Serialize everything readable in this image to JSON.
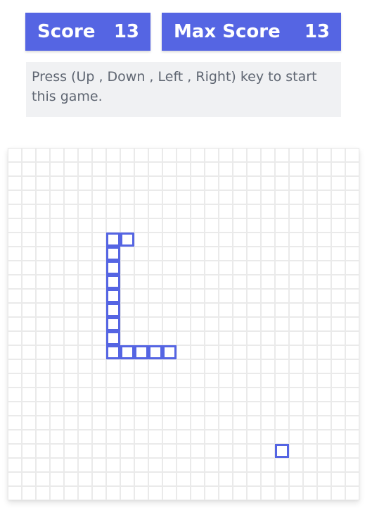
{
  "scores": {
    "score_label": "Score",
    "score_value": "13",
    "max_label": "Max Score",
    "max_value": "13"
  },
  "instructions": "Press (Up , Down , Left , Right) key to start this game.",
  "board": {
    "columns": 25,
    "rows": 25,
    "snake": [
      {
        "col": 7,
        "row": 6
      },
      {
        "col": 8,
        "row": 6
      },
      {
        "col": 7,
        "row": 7
      },
      {
        "col": 7,
        "row": 8
      },
      {
        "col": 7,
        "row": 9
      },
      {
        "col": 7,
        "row": 10
      },
      {
        "col": 7,
        "row": 11
      },
      {
        "col": 7,
        "row": 12
      },
      {
        "col": 7,
        "row": 13
      },
      {
        "col": 7,
        "row": 14
      },
      {
        "col": 8,
        "row": 14
      },
      {
        "col": 9,
        "row": 14
      },
      {
        "col": 10,
        "row": 14
      },
      {
        "col": 11,
        "row": 14
      }
    ],
    "food": {
      "col": 19,
      "row": 21
    }
  },
  "colors": {
    "accent": "#5565e3",
    "grid_line": "#eaeaea",
    "instruction_bg": "#f0f1f3",
    "instruction_text": "#5f6672"
  }
}
